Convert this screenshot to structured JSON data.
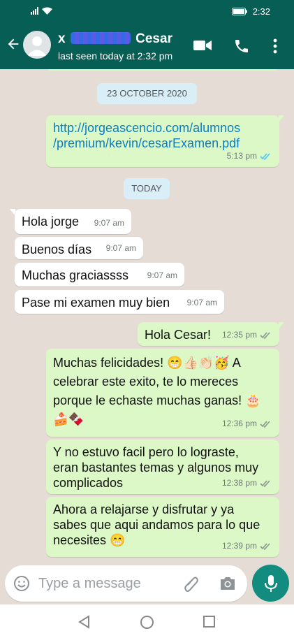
{
  "status_bar": {
    "time": "2:32"
  },
  "header": {
    "name_prefix": "x",
    "name_suffix": "Cesar",
    "last_seen": "last seen today at 2:32 pm"
  },
  "chat": {
    "date_1": "23 OCTOBER 2020",
    "date_2": "TODAY",
    "messages": [
      {
        "text_1": "http://jorgeascencio.com/alumnos",
        "text_2": "/premium/kevin/cesarExamen.pdf",
        "time": "5:13 pm",
        "direction": "out",
        "ticks": "read"
      },
      {
        "text": "Hola jorge",
        "time": "9:07 am",
        "direction": "in"
      },
      {
        "text": "Buenos días",
        "time": "9:07 am",
        "direction": "in"
      },
      {
        "text": "Muchas graciassss",
        "time": "9:07 am",
        "direction": "in"
      },
      {
        "text": "Pase mi examen muy bien",
        "time": "9:07 am",
        "direction": "in"
      },
      {
        "text": "Hola Cesar!",
        "time": "12:35 pm",
        "direction": "out",
        "ticks": "delivered"
      },
      {
        "text_1": "Muchas felicidades! 😁👍🏻👏🏻🥳 A",
        "text_2": "celebrar este exito, te lo mereces",
        "text_3": "porque le echaste muchas ganas! 🎂",
        "text_4": "🍰🍫",
        "time": "12:36 pm",
        "direction": "out",
        "ticks": "delivered"
      },
      {
        "text_1": "Y no estuvo facil pero lo lograste,",
        "text_2": "eran bastantes temas y algunos muy",
        "text_3": "complicados",
        "time": "12:38 pm",
        "direction": "out",
        "ticks": "delivered"
      },
      {
        "text_1": "Ahora a relajarse y disfrutar y ya",
        "text_2": "sabes que aqui andamos para lo que",
        "text_3": "necesites 😁",
        "time": "12:39 pm",
        "direction": "out",
        "ticks": "delivered"
      }
    ]
  },
  "composer": {
    "placeholder": "Type a message"
  },
  "colors": {
    "header": "#075e54",
    "outgoing": "#dcf8c6",
    "incoming": "#ffffff",
    "fab": "#128c7e",
    "read_ticks": "#4fc3f7"
  }
}
